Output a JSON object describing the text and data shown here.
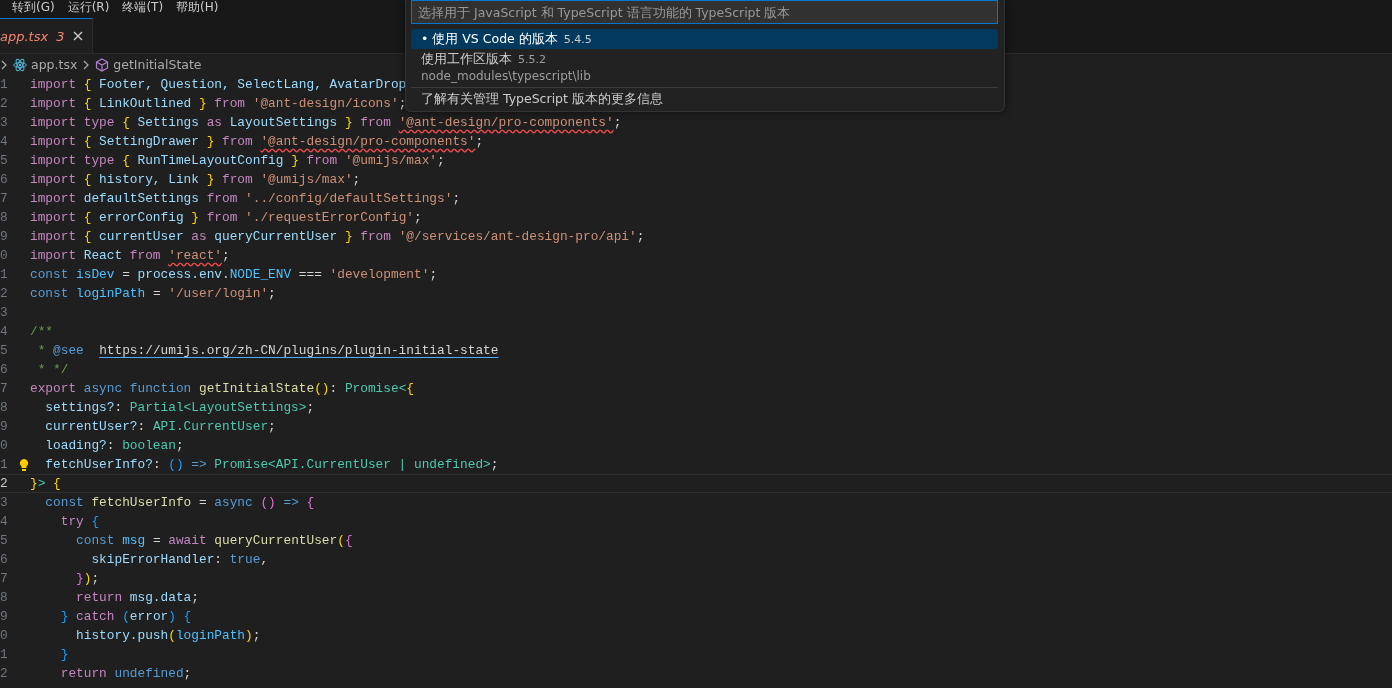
{
  "menu_bar": {
    "items": [
      "转到(G)",
      "运行(R)",
      "终端(T)",
      "帮助(H)"
    ]
  },
  "tabs": [
    {
      "label": "app.tsx",
      "problems": "3",
      "selected": true,
      "has_errors": true
    }
  ],
  "breadcrumb": [
    {
      "label": "app.tsx",
      "kind": "file"
    },
    {
      "label": "getInitialState",
      "kind": "function"
    }
  ],
  "code": {
    "lines": [
      {
        "number": "1",
        "current": false,
        "lightbulb": false,
        "tokens": [
          {
            "text": "import",
            "kind": "kw"
          },
          {
            "text": " {",
            "kind": "b1"
          },
          {
            "text": " Footer, Question, SelectLang, AvatarDrop",
            "kind": "v"
          }
        ]
      },
      {
        "number": "2",
        "current": false,
        "lightbulb": false,
        "tokens": [
          {
            "text": "import",
            "kind": "kw"
          },
          {
            "text": " {",
            "kind": "b1"
          },
          {
            "text": " LinkOutlined ",
            "kind": "v"
          },
          {
            "text": "}",
            "kind": "b1"
          },
          {
            "text": " from",
            "kind": "kw"
          },
          {
            "text": " '@ant-design/icons'",
            "kind": "s"
          },
          {
            "text": ";",
            "kind": "p"
          }
        ]
      },
      {
        "number": "3",
        "current": false,
        "lightbulb": false,
        "tokens": [
          {
            "text": "import",
            "kind": "kw"
          },
          {
            "text": " type",
            "kind": "kw"
          },
          {
            "text": " {",
            "kind": "b1"
          },
          {
            "text": " Settings",
            "kind": "v"
          },
          {
            "text": " as",
            "kind": "kw"
          },
          {
            "text": " LayoutSettings ",
            "kind": "v"
          },
          {
            "text": "}",
            "kind": "b1"
          },
          {
            "text": " from ",
            "kind": "kw"
          },
          {
            "text": "'@ant-design/pro-components'",
            "kind": "s",
            "squiggle": true
          },
          {
            "text": ";",
            "kind": "p"
          }
        ]
      },
      {
        "number": "4",
        "current": false,
        "lightbulb": false,
        "tokens": [
          {
            "text": "import",
            "kind": "kw"
          },
          {
            "text": " {",
            "kind": "b1"
          },
          {
            "text": " SettingDrawer ",
            "kind": "v"
          },
          {
            "text": "}",
            "kind": "b1"
          },
          {
            "text": " from ",
            "kind": "kw"
          },
          {
            "text": "'@ant-design/pro-components'",
            "kind": "s",
            "squiggle": true
          },
          {
            "text": ";",
            "kind": "p"
          }
        ]
      },
      {
        "number": "5",
        "current": false,
        "lightbulb": false,
        "tokens": [
          {
            "text": "import",
            "kind": "kw"
          },
          {
            "text": " type",
            "kind": "kw"
          },
          {
            "text": " {",
            "kind": "b1"
          },
          {
            "text": " RunTimeLayoutConfig ",
            "kind": "v"
          },
          {
            "text": "}",
            "kind": "b1"
          },
          {
            "text": " from",
            "kind": "kw"
          },
          {
            "text": " '@umijs/max'",
            "kind": "s"
          },
          {
            "text": ";",
            "kind": "p"
          }
        ]
      },
      {
        "number": "6",
        "current": false,
        "lightbulb": false,
        "tokens": [
          {
            "text": "import",
            "kind": "kw"
          },
          {
            "text": " {",
            "kind": "b1"
          },
          {
            "text": " history, Link ",
            "kind": "v"
          },
          {
            "text": "}",
            "kind": "b1"
          },
          {
            "text": " from",
            "kind": "kw"
          },
          {
            "text": " '@umijs/max'",
            "kind": "s"
          },
          {
            "text": ";",
            "kind": "p"
          }
        ]
      },
      {
        "number": "7",
        "current": false,
        "lightbulb": false,
        "tokens": [
          {
            "text": "import",
            "kind": "kw"
          },
          {
            "text": " defaultSettings",
            "kind": "v"
          },
          {
            "text": " from",
            "kind": "kw"
          },
          {
            "text": " '../config/defaultSettings'",
            "kind": "s"
          },
          {
            "text": ";",
            "kind": "p"
          }
        ]
      },
      {
        "number": "8",
        "current": false,
        "lightbulb": false,
        "tokens": [
          {
            "text": "import",
            "kind": "kw"
          },
          {
            "text": " {",
            "kind": "b1"
          },
          {
            "text": " errorConfig ",
            "kind": "v"
          },
          {
            "text": "}",
            "kind": "b1"
          },
          {
            "text": " from",
            "kind": "kw"
          },
          {
            "text": " './requestErrorConfig'",
            "kind": "s"
          },
          {
            "text": ";",
            "kind": "p"
          }
        ]
      },
      {
        "number": "9",
        "current": false,
        "lightbulb": false,
        "tokens": [
          {
            "text": "import",
            "kind": "kw"
          },
          {
            "text": " {",
            "kind": "b1"
          },
          {
            "text": " currentUser",
            "kind": "v"
          },
          {
            "text": " as",
            "kind": "kw"
          },
          {
            "text": " queryCurrentUser ",
            "kind": "v"
          },
          {
            "text": "}",
            "kind": "b1"
          },
          {
            "text": " from",
            "kind": "kw"
          },
          {
            "text": " '@/services/ant-design-pro/api'",
            "kind": "s"
          },
          {
            "text": ";",
            "kind": "p"
          }
        ]
      },
      {
        "number": "0",
        "current": false,
        "lightbulb": false,
        "tokens": [
          {
            "text": "import",
            "kind": "kw"
          },
          {
            "text": " React",
            "kind": "v"
          },
          {
            "text": " from ",
            "kind": "kw"
          },
          {
            "text": "'react'",
            "kind": "s",
            "squiggle": true
          },
          {
            "text": ";",
            "kind": "p"
          }
        ]
      },
      {
        "number": "1",
        "current": false,
        "lightbulb": false,
        "tokens": [
          {
            "text": "const",
            "kind": "dc"
          },
          {
            "text": " isDev",
            "kind": "c"
          },
          {
            "text": " = ",
            "kind": "p"
          },
          {
            "text": "process.env.",
            "kind": "v"
          },
          {
            "text": "NODE_ENV",
            "kind": "c"
          },
          {
            "text": " === ",
            "kind": "p"
          },
          {
            "text": "'development'",
            "kind": "s"
          },
          {
            "text": ";",
            "kind": "p"
          }
        ]
      },
      {
        "number": "2",
        "current": false,
        "lightbulb": false,
        "tokens": [
          {
            "text": "const",
            "kind": "dc"
          },
          {
            "text": " loginPath",
            "kind": "c"
          },
          {
            "text": " = ",
            "kind": "p"
          },
          {
            "text": "'/user/login'",
            "kind": "s"
          },
          {
            "text": ";",
            "kind": "p"
          }
        ]
      },
      {
        "number": "3",
        "current": false,
        "lightbulb": false
      },
      {
        "number": "4",
        "current": false,
        "lightbulb": false,
        "tokens": [
          {
            "text": "/**",
            "kind": "cm"
          }
        ]
      },
      {
        "number": "5",
        "current": false,
        "lightbulb": false,
        "tokens": [
          {
            "text": " *",
            "kind": "cm"
          },
          {
            "text": " @see  ",
            "kind": "dc"
          },
          {
            "text": "https://umijs.org/zh-CN/plugins/plugin-initial-state",
            "kind": "link"
          }
        ]
      },
      {
        "number": "6",
        "current": false,
        "lightbulb": false,
        "tokens": [
          {
            "text": " * */",
            "kind": "cm"
          }
        ]
      },
      {
        "number": "7",
        "current": false,
        "lightbulb": false,
        "tokens": [
          {
            "text": "export",
            "kind": "kw"
          },
          {
            "text": " async function",
            "kind": "dc"
          },
          {
            "text": " getInitialState",
            "kind": "f"
          },
          {
            "text": "()",
            "kind": "b1"
          },
          {
            "text": ": ",
            "kind": "p"
          },
          {
            "text": "Promise",
            "kind": "t"
          },
          {
            "text": "<",
            "kind": "t"
          },
          {
            "text": "{",
            "kind": "b1"
          }
        ]
      },
      {
        "number": "8",
        "current": false,
        "lightbulb": false,
        "tokens": [
          {
            "text": "  settings?",
            "kind": "v"
          },
          {
            "text": ": ",
            "kind": "p"
          },
          {
            "text": "Partial<LayoutSettings>",
            "kind": "t"
          },
          {
            "text": ";",
            "kind": "p"
          }
        ]
      },
      {
        "number": "9",
        "current": false,
        "lightbulb": false,
        "tokens": [
          {
            "text": "  currentUser?",
            "kind": "v"
          },
          {
            "text": ": ",
            "kind": "p"
          },
          {
            "text": "API.CurrentUser",
            "kind": "t"
          },
          {
            "text": ";",
            "kind": "p"
          }
        ]
      },
      {
        "number": "0",
        "current": false,
        "lightbulb": false,
        "tokens": [
          {
            "text": "  loading?",
            "kind": "v"
          },
          {
            "text": ": ",
            "kind": "p"
          },
          {
            "text": "boolean",
            "kind": "t"
          },
          {
            "text": ";",
            "kind": "p"
          }
        ]
      },
      {
        "number": "1",
        "current": false,
        "lightbulb": true,
        "tokens": [
          {
            "text": "  fetchUserInfo?",
            "kind": "v"
          },
          {
            "text": ": ",
            "kind": "p"
          },
          {
            "text": "()",
            "kind": "b3"
          },
          {
            "text": " => ",
            "kind": "dc"
          },
          {
            "text": "Promise<API.CurrentUser | undefined>",
            "kind": "t"
          },
          {
            "text": ";",
            "kind": "p"
          }
        ]
      },
      {
        "number": "2",
        "current": true,
        "lightbulb": false,
        "tokens": [
          {
            "text": "}",
            "kind": "b1"
          },
          {
            "text": "> ",
            "kind": "t"
          },
          {
            "text": "{",
            "kind": "b1"
          }
        ]
      },
      {
        "number": "3",
        "current": false,
        "lightbulb": false,
        "tokens": [
          {
            "text": "  const",
            "kind": "dc"
          },
          {
            "text": " fetchUserInfo",
            "kind": "f"
          },
          {
            "text": " = ",
            "kind": "p"
          },
          {
            "text": "async",
            "kind": "dc"
          },
          {
            "text": " ()",
            "kind": "b2"
          },
          {
            "text": " => ",
            "kind": "dc"
          },
          {
            "text": "{",
            "kind": "b2"
          }
        ]
      },
      {
        "number": "4",
        "current": false,
        "lightbulb": false,
        "tokens": [
          {
            "text": "    try",
            "kind": "kw"
          },
          {
            "text": " {",
            "kind": "b3"
          }
        ]
      },
      {
        "number": "5",
        "current": false,
        "lightbulb": false,
        "tokens": [
          {
            "text": "      const",
            "kind": "dc"
          },
          {
            "text": " msg",
            "kind": "c"
          },
          {
            "text": " = ",
            "kind": "p"
          },
          {
            "text": "await",
            "kind": "kw"
          },
          {
            "text": " queryCurrentUser",
            "kind": "f"
          },
          {
            "text": "(",
            "kind": "b1"
          },
          {
            "text": "{",
            "kind": "b2"
          }
        ]
      },
      {
        "number": "6",
        "current": false,
        "lightbulb": false,
        "tokens": [
          {
            "text": "        skipErrorHandler",
            "kind": "v"
          },
          {
            "text": ": ",
            "kind": "p"
          },
          {
            "text": "true",
            "kind": "dc"
          },
          {
            "text": ",",
            "kind": "p"
          }
        ]
      },
      {
        "number": "7",
        "current": false,
        "lightbulb": false,
        "tokens": [
          {
            "text": "      }",
            "kind": "b2"
          },
          {
            "text": ")",
            "kind": "b1"
          },
          {
            "text": ";",
            "kind": "p"
          }
        ]
      },
      {
        "number": "8",
        "current": false,
        "lightbulb": false,
        "tokens": [
          {
            "text": "      return",
            "kind": "kw"
          },
          {
            "text": " msg.data",
            "kind": "v"
          },
          {
            "text": ";",
            "kind": "p"
          }
        ]
      },
      {
        "number": "9",
        "current": false,
        "lightbulb": false,
        "tokens": [
          {
            "text": "    }",
            "kind": "b3"
          },
          {
            "text": " catch",
            "kind": "kw"
          },
          {
            "text": " (",
            "kind": "b3"
          },
          {
            "text": "error",
            "kind": "v"
          },
          {
            "text": ")",
            "kind": "b3"
          },
          {
            "text": " {",
            "kind": "b3"
          }
        ]
      },
      {
        "number": "0",
        "current": false,
        "lightbulb": false,
        "tokens": [
          {
            "text": "      history.push",
            "kind": "v"
          },
          {
            "text": "(",
            "kind": "b1"
          },
          {
            "text": "loginPath",
            "kind": "c"
          },
          {
            "text": ")",
            "kind": "b1"
          },
          {
            "text": ";",
            "kind": "p"
          }
        ]
      },
      {
        "number": "1",
        "current": false,
        "lightbulb": false,
        "tokens": [
          {
            "text": "    }",
            "kind": "b3"
          }
        ]
      },
      {
        "number": "2",
        "current": false,
        "lightbulb": false,
        "tokens": [
          {
            "text": "    return",
            "kind": "kw"
          },
          {
            "text": " undefined",
            "kind": "dc"
          },
          {
            "text": ";",
            "kind": "p"
          }
        ]
      }
    ]
  },
  "quick_pick": {
    "placeholder": "选择用于 JavaScript 和 TypeScript 语言功能的 TypeScript 版本",
    "items": [
      {
        "label": "• 使用 VS Code 的版本",
        "description": "5.4.5",
        "selected": true,
        "separator_before": false
      },
      {
        "label": "使用工作区版本",
        "description": "5.5.2",
        "detail": "node_modules\\typescript\\lib",
        "selected": false,
        "separator_before": false
      },
      {
        "label": "了解有关管理 TypeScript 版本的更多信息",
        "selected": false,
        "separator_before": true
      }
    ]
  }
}
